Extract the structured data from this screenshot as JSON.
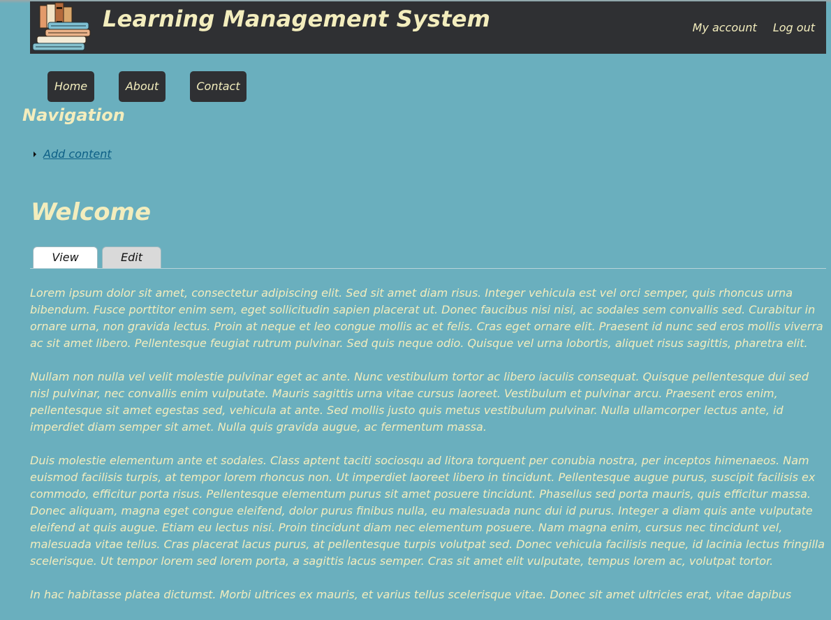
{
  "header": {
    "site_title": "Learning Management System",
    "user_links": [
      "My account",
      "Log out"
    ]
  },
  "primary_nav": [
    "Home",
    "About",
    "Contact"
  ],
  "sidebar": {
    "title": "Navigation",
    "items": [
      "Add content"
    ]
  },
  "page": {
    "title": "Welcome",
    "tabs": [
      "View",
      "Edit"
    ],
    "active_tab": "View",
    "paragraphs": [
      "Lorem ipsum dolor sit amet, consectetur adipiscing elit. Sed sit amet diam risus. Integer vehicula est vel orci semper, quis rhoncus urna bibendum. Fusce porttitor enim sem, eget sollicitudin sapien placerat ut. Donec faucibus nisi nisi, ac sodales sem convallis sed. Curabitur in ornare urna, non gravida lectus. Proin at neque et leo congue mollis ac et felis. Cras eget ornare elit. Praesent id nunc sed eros mollis viverra ac sit amet libero. Pellentesque feugiat rutrum pulvinar. Sed quis neque odio. Quisque vel urna lobortis, aliquet risus sagittis, pharetra elit.",
      "Nullam non nulla vel velit molestie pulvinar eget ac ante. Nunc vestibulum tortor ac libero iaculis consequat. Quisque pellentesque dui sed nisl pulvinar, nec convallis enim vulputate. Mauris sagittis urna vitae cursus laoreet. Vestibulum et pulvinar arcu. Praesent eros enim, pellentesque sit amet egestas sed, vehicula at ante. Sed mollis justo quis metus vestibulum pulvinar. Nulla ullamcorper lectus ante, id imperdiet diam semper sit amet. Nulla quis gravida augue, ac fermentum massa.",
      "Duis molestie elementum ante et sodales. Class aptent taciti sociosqu ad litora torquent per conubia nostra, per inceptos himenaeos. Nam euismod facilisis turpis, at tempor lorem rhoncus non. Ut imperdiet laoreet libero in tincidunt. Pellentesque augue purus, suscipit facilisis ex commodo, efficitur porta risus. Pellentesque elementum purus sit amet posuere tincidunt. Phasellus sed porta mauris, quis efficitur massa. Donec aliquam, magna eget congue eleifend, dolor purus finibus nulla, eu malesuada nunc dui id purus. Integer a diam quis ante vulputate eleifend at quis augue. Etiam eu lectus nisi. Proin tincidunt diam nec elementum posuere. Nam magna enim, cursus nec tincidunt vel, malesuada vitae tellus. Cras placerat lacus purus, at pellentesque turpis volutpat sed. Donec vehicula facilisis neque, id lacinia lectus fringilla scelerisque. Ut tempor lorem sed lorem porta, a sagittis lacus semper. Cras sit amet elit vulputate, tempus lorem ac, volutpat tortor.",
      "In hac habitasse platea dictumst. Morbi ultrices ex mauris, et varius tellus scelerisque vitae. Donec sit amet ultricies erat, vitae dapibus"
    ]
  },
  "colors": {
    "background": "#6aafbe",
    "header_bg": "#2f3033",
    "accent_text": "#f3edbd",
    "link": "#0d5f86"
  },
  "icons": {
    "logo": "books-stack-icon",
    "list_bullet": "triangle-bullet-icon"
  }
}
